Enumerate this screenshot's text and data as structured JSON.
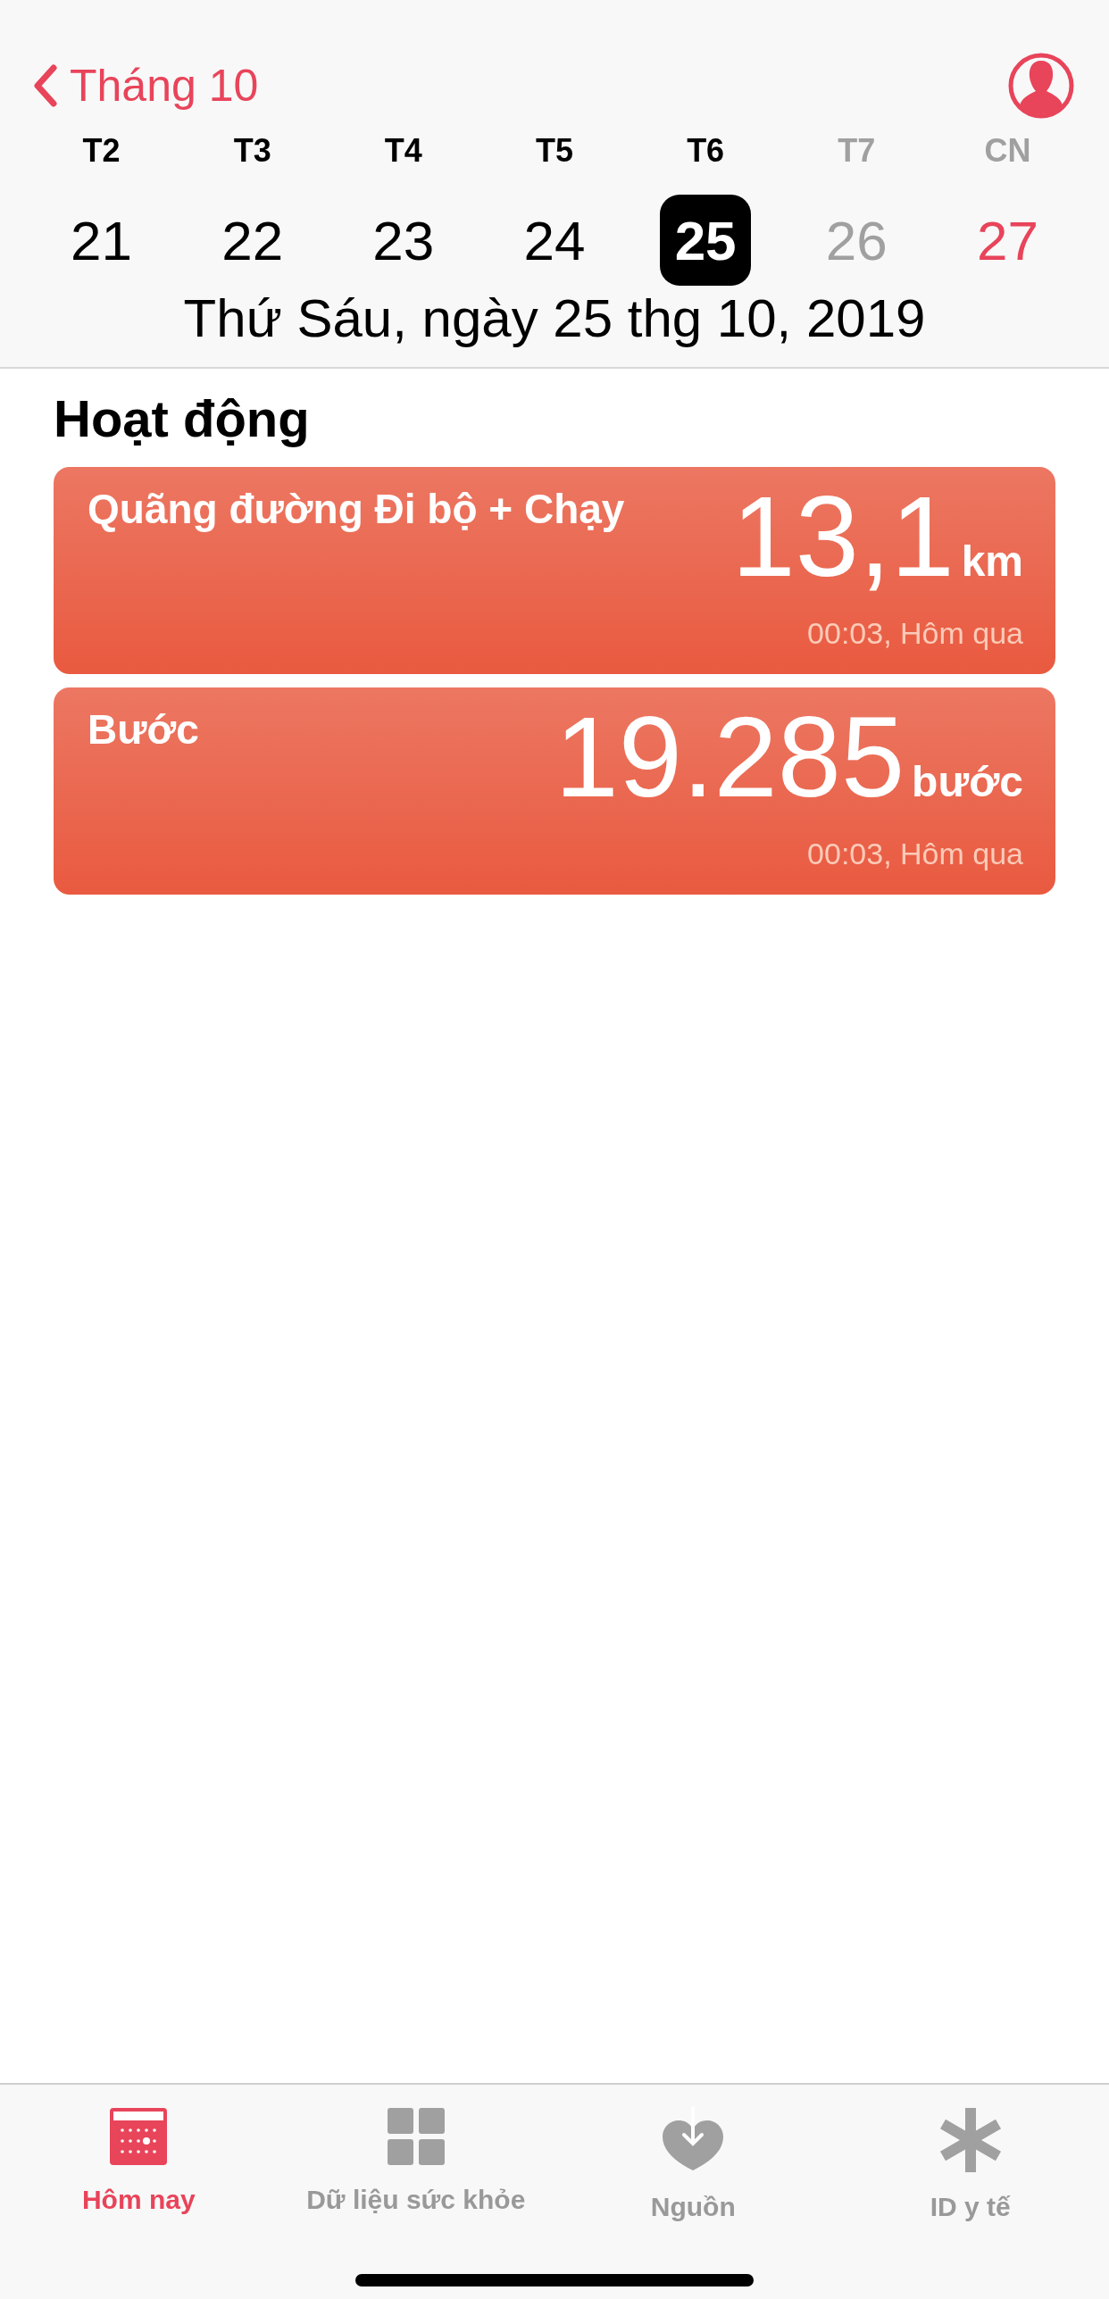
{
  "header": {
    "back_label": "Tháng 10",
    "days": [
      {
        "weekday": "T2",
        "date": "21",
        "kind": "weekday",
        "selected": false
      },
      {
        "weekday": "T3",
        "date": "22",
        "kind": "weekday",
        "selected": false
      },
      {
        "weekday": "T4",
        "date": "23",
        "kind": "weekday",
        "selected": false
      },
      {
        "weekday": "T5",
        "date": "24",
        "kind": "weekday",
        "selected": false
      },
      {
        "weekday": "T6",
        "date": "25",
        "kind": "weekday",
        "selected": true
      },
      {
        "weekday": "T7",
        "date": "26",
        "kind": "saturday",
        "selected": false
      },
      {
        "weekday": "CN",
        "date": "27",
        "kind": "sunday",
        "selected": false
      }
    ],
    "full_date": "Thứ Sáu, ngày 25 thg 10, 2019"
  },
  "section": {
    "title": "Hoạt động",
    "cards": [
      {
        "title": "Quãng đường Đi bộ + Chạy",
        "value": "13,1",
        "unit": "km",
        "time": "00:03, Hôm qua"
      },
      {
        "title": "Bước",
        "value": "19.285",
        "unit": "bước",
        "time": "00:03, Hôm qua"
      }
    ]
  },
  "tab_bar": [
    {
      "label": "Hôm nay",
      "kind": "calendar",
      "selected": true
    },
    {
      "label": "Dữ liệu sức khỏe",
      "kind": "grid",
      "selected": false
    },
    {
      "label": "Nguồn",
      "kind": "heart",
      "selected": false
    },
    {
      "label": "ID y tế",
      "kind": "asterisk",
      "selected": false
    }
  ]
}
